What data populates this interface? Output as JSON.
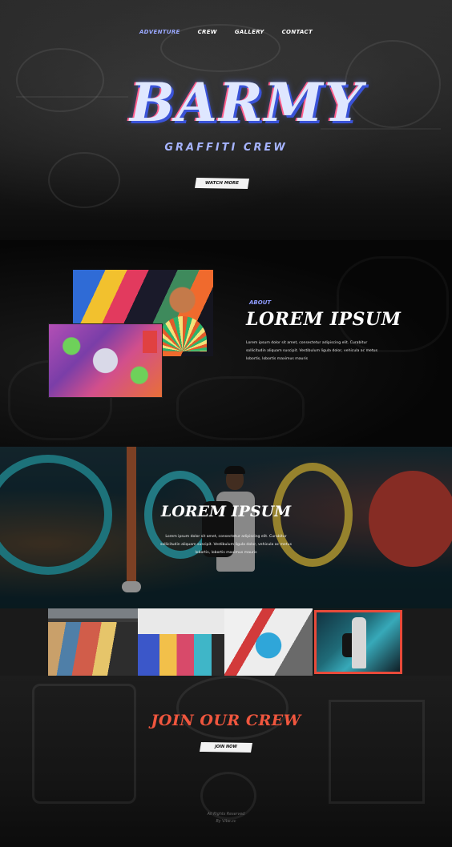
{
  "nav": {
    "items": [
      {
        "label": "ADVENTURE",
        "active": true
      },
      {
        "label": "CREW",
        "active": false
      },
      {
        "label": "GALLERY",
        "active": false
      },
      {
        "label": "CONTACT",
        "active": false
      }
    ]
  },
  "hero": {
    "logo_text": "BARMY",
    "subtitle": "GRAFFITI CREW",
    "button_label": "WATCH MORE"
  },
  "about": {
    "eyebrow": "ABOUT",
    "title": "LOREM IPSUM",
    "body": "Lorem ipsum dolor sit amet, consectetur adipiscing elit. Curabitur sollicitudin aliquam suscipit. Vestibulum ligula dolor, vehicula ac metus lobortis, lobortis maximus mauris"
  },
  "feature": {
    "title": "LOREM IPSUM",
    "body": "Lorem ipsum dolor sit amet, consectetur adipiscing elit. Curabitur sollicitudin aliquam suscipit. Vestibulum ligula dolor, vehicula ac metus lobortis, lobortis maximus mauris"
  },
  "join": {
    "title": "JOIN OUR CREW",
    "button_label": "JOIN NOW"
  },
  "footer": {
    "line1": "All Rights Reserved",
    "line2": "By Vibe.cc"
  },
  "colors": {
    "accent_blue": "#8f9cff",
    "accent_red": "#f0563e",
    "gallery_highlight": "#e84a3a"
  }
}
